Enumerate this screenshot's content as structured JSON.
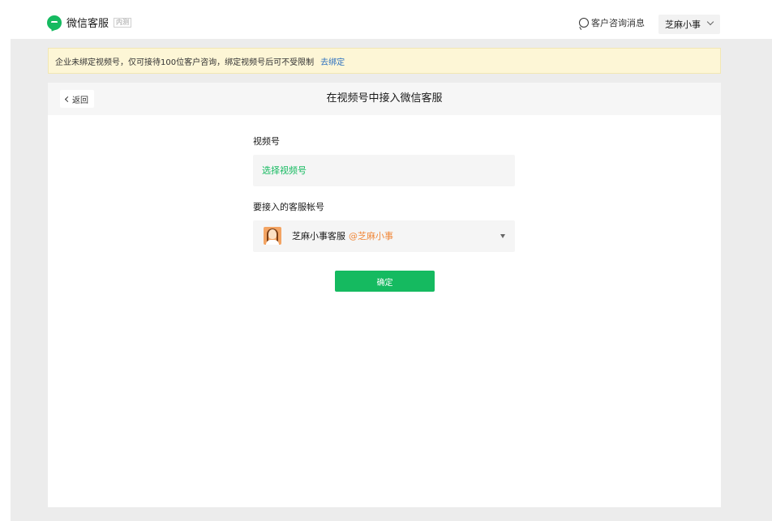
{
  "header": {
    "app_title": "微信客服",
    "badge": "内测",
    "messages_label": "客户咨询消息",
    "account_name": "芝麻小事"
  },
  "notice": {
    "text": "企业未绑定视频号，仅可接待100位客户咨询，绑定视频号后可不受限制",
    "link_label": "去绑定"
  },
  "panel": {
    "back_label": "返回",
    "title": "在视频号中接入微信客服",
    "channel_label": "视频号",
    "channel_placeholder": "选择视频号",
    "account_label": "要接入的客服帐号",
    "account": {
      "name": "芝麻小事客服",
      "handle": "@芝麻小事"
    },
    "confirm_label": "确定"
  },
  "colors": {
    "accent": "#15ba60",
    "notice_bg": "#fdf6d6",
    "link": "#2b6fbf",
    "handle": "#f0883a"
  }
}
